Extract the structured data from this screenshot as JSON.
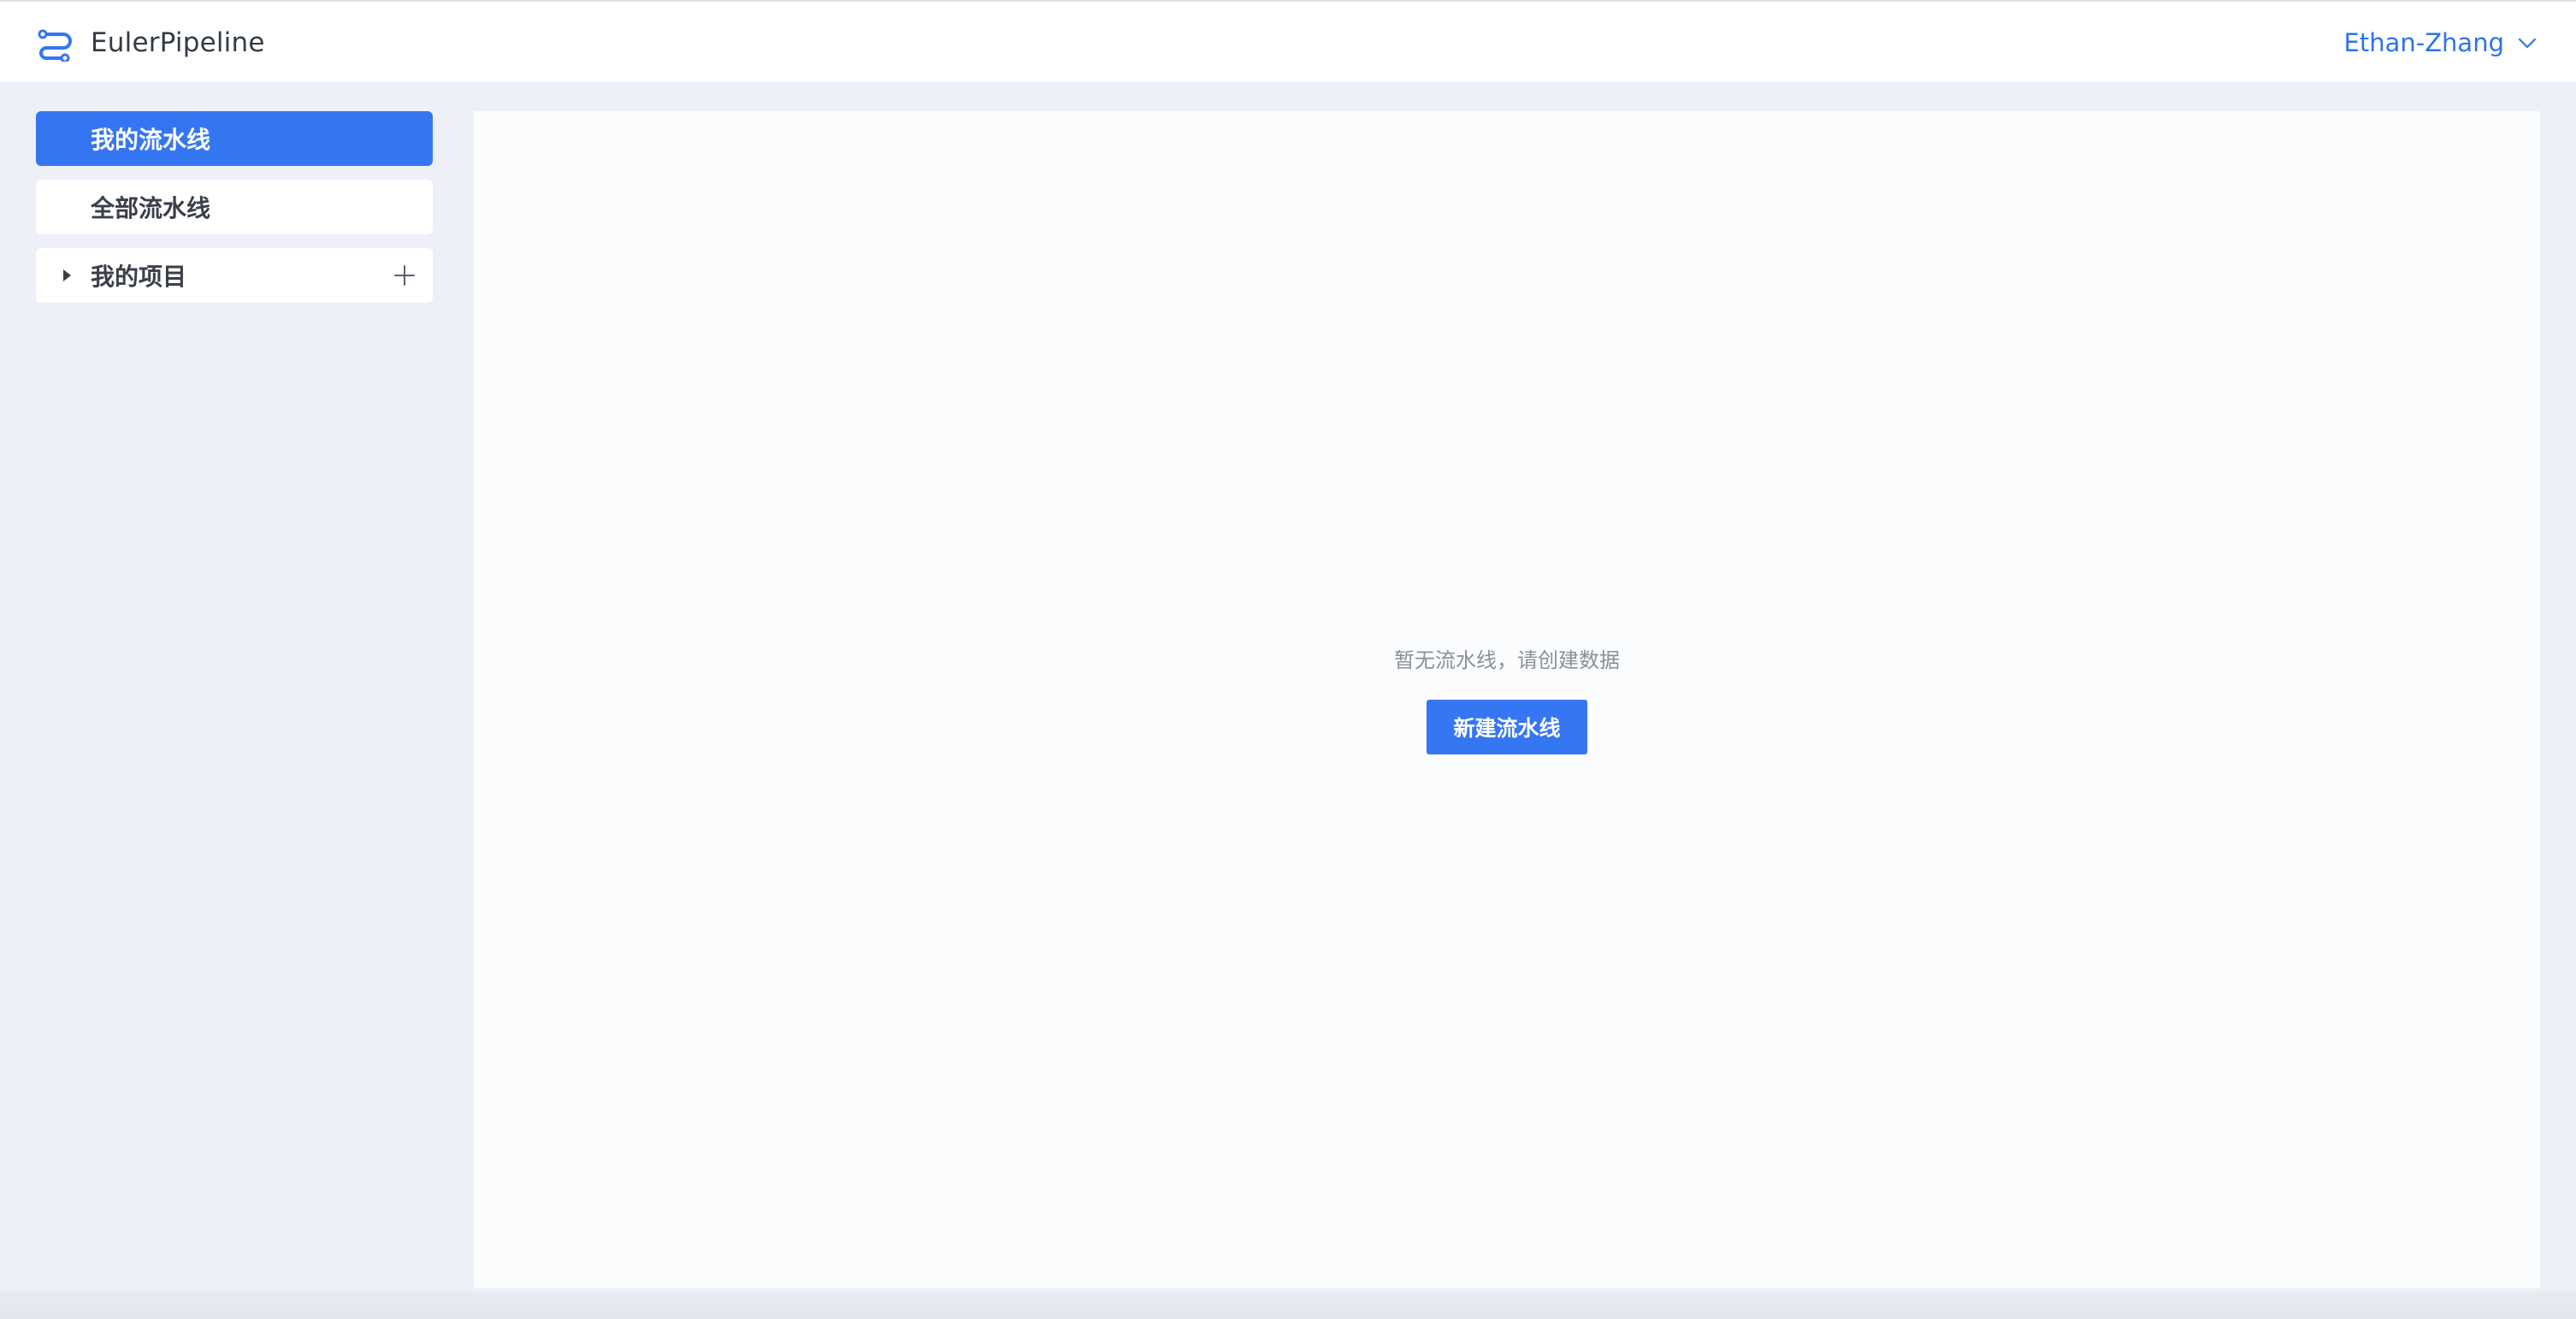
{
  "header": {
    "app_name": "EulerPipeline",
    "logo_icon": "pipeline-logo-icon",
    "user_name": "Ethan-Zhang",
    "user_chevron_icon": "chevron-down-icon"
  },
  "sidebar": {
    "items": [
      {
        "label": "我的流水线",
        "active": true
      },
      {
        "label": "全部流水线",
        "active": false
      },
      {
        "label": "我的项目",
        "expandable": true,
        "expand_icon": "caret-right-icon",
        "add_icon": "plus-icon"
      }
    ]
  },
  "main": {
    "empty_message": "暂无流水线，请创建数据",
    "create_button_label": "新建流水线"
  },
  "colors": {
    "accent": "#3476f2",
    "user_link": "#2d74e8",
    "page_background": "#edf0f7"
  }
}
